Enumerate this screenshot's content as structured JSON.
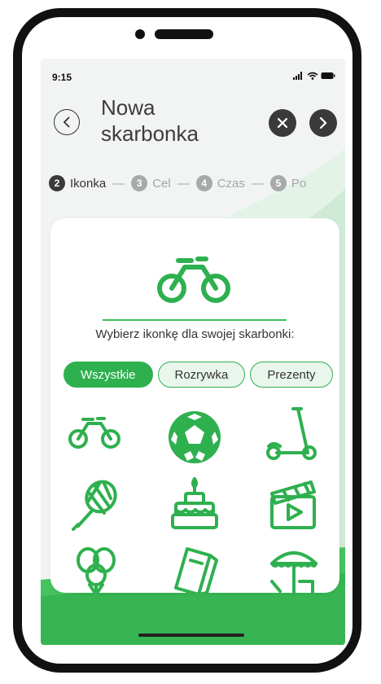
{
  "status_bar": {
    "time": "9:15"
  },
  "header": {
    "title": "Nowa skarbonka"
  },
  "stepper": [
    {
      "num": "2",
      "label": "Ikonka",
      "active": true
    },
    {
      "num": "3",
      "label": "Cel",
      "active": false
    },
    {
      "num": "4",
      "label": "Czas",
      "active": false
    },
    {
      "num": "5",
      "label": "Po",
      "active": false
    }
  ],
  "card": {
    "prompt": "Wybierz ikonkę dla swojej skarbonki:",
    "chips": [
      "Wszystkie",
      "Rozrywka",
      "Prezenty"
    ],
    "icons": [
      "bicycle-icon",
      "soccer-ball-icon",
      "scooter-icon",
      "tennis-racket-icon",
      "birthday-cake-icon",
      "movie-clapper-icon",
      "balloons-icon",
      "tickets-icon",
      "beach-umbrella-icon"
    ]
  },
  "colors": {
    "accent": "#2fb04f",
    "dark_button": "#3a3a3a"
  }
}
